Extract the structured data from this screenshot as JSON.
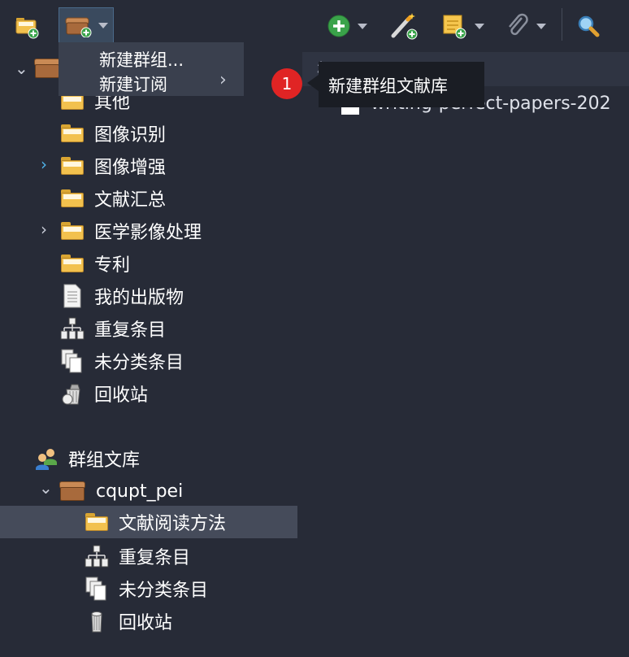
{
  "toolbar": {
    "buttons": [
      {
        "name": "new-collection-button",
        "icon": "folder-plus-icon"
      },
      {
        "name": "new-library-button",
        "icon": "library-plus-icon",
        "has_dropdown": true
      },
      {
        "name": "new-item-button",
        "icon": "green-plus-icon",
        "has_dropdown": true
      },
      {
        "name": "add-by-identifier-button",
        "icon": "magic-wand-icon"
      },
      {
        "name": "new-note-button",
        "icon": "note-plus-icon",
        "has_dropdown": true
      },
      {
        "name": "add-attachment-button",
        "icon": "paperclip-icon",
        "has_dropdown": true
      },
      {
        "name": "search-button",
        "icon": "search-icon"
      }
    ]
  },
  "menu": {
    "items": [
      "新建群组...",
      "新建订阅"
    ],
    "submenu_arrow": "›"
  },
  "tooltip": {
    "badge": "1",
    "text": "新建群组文献库"
  },
  "column_header": "标题",
  "items": [
    {
      "title": "writing-perfect-papers-202",
      "icon": "pdf-icon"
    }
  ],
  "tree": {
    "my_library_items": [
      {
        "label": "其他",
        "icon": "folder-icon",
        "expandable": false
      },
      {
        "label": "图像识别",
        "icon": "folder-icon",
        "expandable": false
      },
      {
        "label": "图像增强",
        "icon": "folder-icon",
        "expandable": true,
        "chevron_color": "#4fb3e8"
      },
      {
        "label": "文献汇总",
        "icon": "folder-icon",
        "expandable": false
      },
      {
        "label": "医学影像处理",
        "icon": "folder-icon",
        "expandable": true,
        "chevron_color": "#c7cbd6"
      },
      {
        "label": "专利",
        "icon": "folder-icon",
        "expandable": false
      },
      {
        "label": "我的出版物",
        "icon": "document-icon",
        "expandable": false
      },
      {
        "label": "重复条目",
        "icon": "duplicate-icon",
        "expandable": false
      },
      {
        "label": "未分类条目",
        "icon": "unfiled-icon",
        "expandable": false
      },
      {
        "label": "回收站",
        "icon": "trash-icon",
        "expandable": false
      }
    ],
    "group_header": {
      "label": "群组文库",
      "icon": "group-icon"
    },
    "group_library": {
      "label": "cqupt_pei",
      "icon": "library-icon"
    },
    "group_items": [
      {
        "label": "文献阅读方法",
        "icon": "folder-icon",
        "selected": true
      },
      {
        "label": "重复条目",
        "icon": "duplicate-icon",
        "selected": false
      },
      {
        "label": "未分类条目",
        "icon": "unfiled-icon",
        "selected": false
      },
      {
        "label": "回收站",
        "icon": "trash-icon",
        "selected": false
      }
    ]
  },
  "colors": {
    "background": "#272b37",
    "selected_row": "#454b5a",
    "menu_bg": "#3a404e",
    "tooltip_bg": "#1a1d24",
    "badge": "#e02424"
  }
}
